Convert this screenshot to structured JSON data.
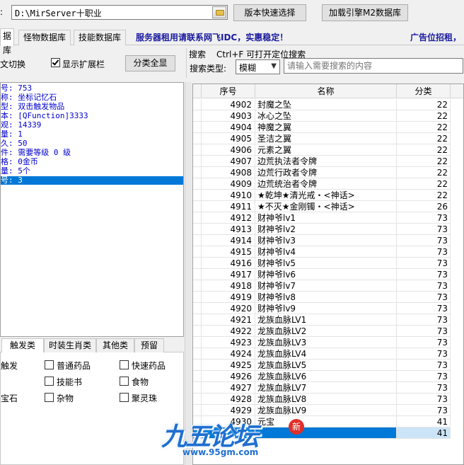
{
  "toolbar": {
    "path_label": ":",
    "path_value": "D:\\MirServer十职业",
    "version_button": "版本快速选择",
    "load_button": "加载引擎M2数据库"
  },
  "tabs": [
    {
      "label": "据库",
      "active": true
    },
    {
      "label": "怪物数据库",
      "active": false
    },
    {
      "label": "技能数据库",
      "active": false
    }
  ],
  "banner": "服务器租用请联系网飞IDC，实惠稳定！",
  "ad": "广告位招租，",
  "options": {
    "lang_toggle": "文切换",
    "show_ext_label": "显示扩展栏",
    "show_ext_checked": true,
    "expand_button": "分类全显"
  },
  "search": {
    "title": "搜索",
    "hint": "Ctrl+F 可打开定位搜索",
    "type_label": "搜索类型:",
    "type_value": "模糊",
    "placeholder": "请输入需要搜索的内容"
  },
  "info_rows": [
    "号: 753",
    "称: 坐标记忆石",
    "型: 双击触发物品",
    "本: [QFunction]3333",
    "观: 14339",
    "量: 1",
    "久: 50",
    "件: 需要等级 0 级",
    "格: 0金币",
    "量: 5个",
    "号: 3"
  ],
  "info_selected_index": 10,
  "category_tabs": [
    {
      "label": "触发类",
      "active": true
    },
    {
      "label": "时装生肖类",
      "active": false
    },
    {
      "label": "其他类",
      "active": false
    },
    {
      "label": "预留",
      "active": false
    }
  ],
  "category_checks": [
    {
      "label": "触发"
    },
    {
      "label": "普通药品"
    },
    {
      "label": "快速药品"
    },
    {
      "label": ""
    },
    {
      "label": "技能书"
    },
    {
      "label": "食物"
    },
    {
      "label": "宝石"
    },
    {
      "label": "杂物"
    },
    {
      "label": "聚灵珠"
    }
  ],
  "grid": {
    "headers": [
      "序号",
      "名称",
      "分类"
    ],
    "rows": [
      {
        "id": "4902",
        "name": "封魔之坠",
        "cat": "22"
      },
      {
        "id": "4903",
        "name": "冰心之坠",
        "cat": "22"
      },
      {
        "id": "4904",
        "name": "神魔之翼",
        "cat": "22"
      },
      {
        "id": "4905",
        "name": "圣洁之翼",
        "cat": "22"
      },
      {
        "id": "4906",
        "name": "元素之翼",
        "cat": "22"
      },
      {
        "id": "4907",
        "name": "边荒执法者令牌",
        "cat": "22"
      },
      {
        "id": "4908",
        "name": "边荒行政者令牌",
        "cat": "22"
      },
      {
        "id": "4909",
        "name": "边荒统治者令牌",
        "cat": "22"
      },
      {
        "id": "4910",
        "name": "★乾坤★清光戒・<神话>",
        "cat": "22"
      },
      {
        "id": "4911",
        "name": "★不灭★金刚镯・<神话>",
        "cat": "26"
      },
      {
        "id": "4912",
        "name": "财神爷lv1",
        "cat": "73"
      },
      {
        "id": "4913",
        "name": "财神爷lv2",
        "cat": "73"
      },
      {
        "id": "4914",
        "name": "财神爷lv3",
        "cat": "73"
      },
      {
        "id": "4915",
        "name": "财神爷lv4",
        "cat": "73"
      },
      {
        "id": "4916",
        "name": "财神爷lv5",
        "cat": "73"
      },
      {
        "id": "4917",
        "name": "财神爷lv6",
        "cat": "73"
      },
      {
        "id": "4918",
        "name": "财神爷lv7",
        "cat": "73"
      },
      {
        "id": "4919",
        "name": "财神爷lv8",
        "cat": "73"
      },
      {
        "id": "4920",
        "name": "财神爷lv9",
        "cat": "73"
      },
      {
        "id": "4921",
        "name": "龙族血脉LV1",
        "cat": "73"
      },
      {
        "id": "4922",
        "name": "龙族血脉LV2",
        "cat": "73"
      },
      {
        "id": "4923",
        "name": "龙族血脉LV3",
        "cat": "73"
      },
      {
        "id": "4924",
        "name": "龙族血脉LV4",
        "cat": "73"
      },
      {
        "id": "4925",
        "name": "龙族血脉LV5",
        "cat": "73"
      },
      {
        "id": "4926",
        "name": "龙族血脉LV6",
        "cat": "73"
      },
      {
        "id": "4927",
        "name": "龙族血脉LV7",
        "cat": "73"
      },
      {
        "id": "4928",
        "name": "龙族血脉LV8",
        "cat": "73"
      },
      {
        "id": "4929",
        "name": "龙族血脉LV9",
        "cat": "73"
      },
      {
        "id": "4930",
        "name": "元宝",
        "cat": "41"
      },
      {
        "id": "",
        "name": "",
        "cat": "41"
      }
    ],
    "selected_index": 29
  },
  "watermark": {
    "logo": "九五论坛",
    "url": "www.95gm.com",
    "seal": "新"
  },
  "colors": {
    "selection": "#0078d7",
    "info_text": "#0000cc",
    "banner_text": "#1a1aa0"
  }
}
